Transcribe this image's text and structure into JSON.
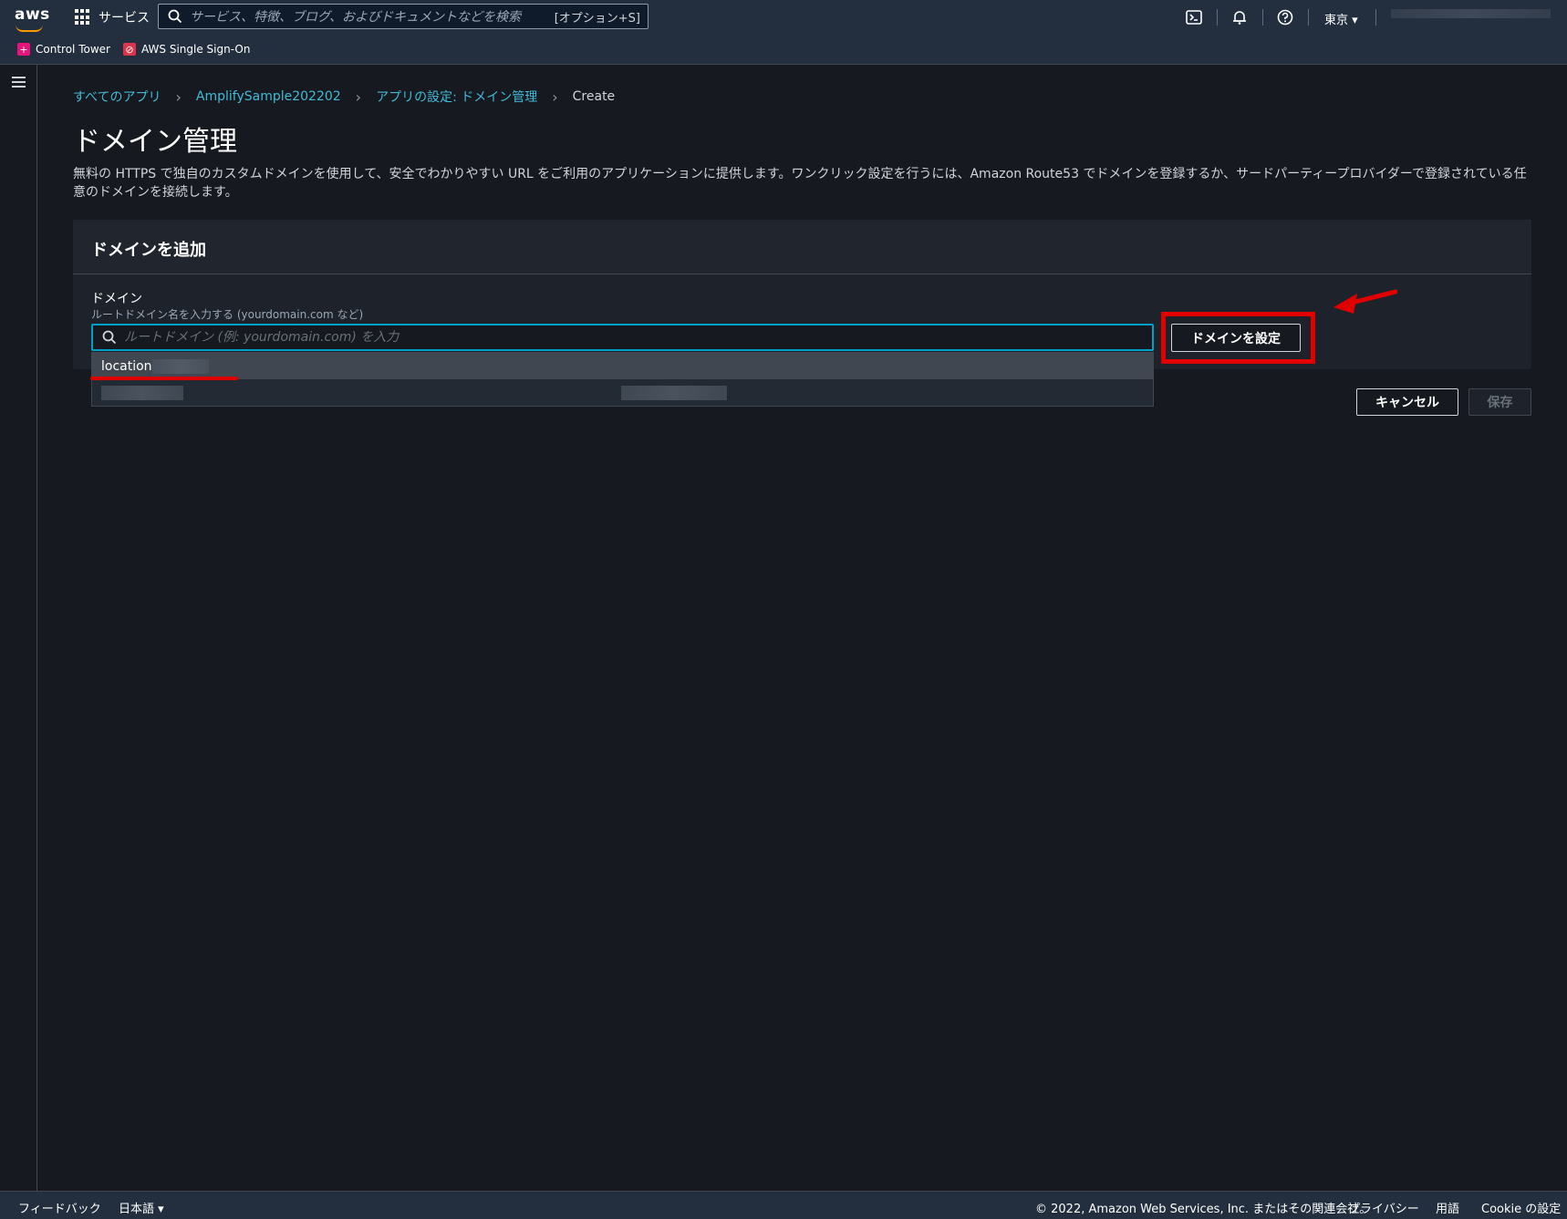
{
  "topbar": {
    "logo": "aws",
    "services_label": "サービス",
    "search_placeholder": "サービス、特徴、ブログ、およびドキュメントなどを検索",
    "search_shortcut": "[オプション+S]",
    "region": "東京 ▾",
    "icons": [
      "cloudshell-icon",
      "bell-icon",
      "help-icon"
    ]
  },
  "favorites": [
    {
      "label": "Control Tower",
      "color": "#e7157b"
    },
    {
      "label": "AWS Single Sign-On",
      "color": "#dd344c"
    }
  ],
  "breadcrumb": {
    "items": [
      "すべてのアプリ",
      "AmplifySample202202",
      "アプリの設定: ドメイン管理"
    ],
    "current": "Create"
  },
  "page": {
    "title": "ドメイン管理",
    "description": "無料の HTTPS で独自のカスタムドメインを使用して、安全でわかりやすい URL をご利用のアプリケーションに提供します。ワンクリック設定を行うには、Amazon Route53 でドメインを登録するか、サードパーティープロバイダーで登録されている任意のドメインを接続します。"
  },
  "panel": {
    "title": "ドメインを追加",
    "field_label": "ドメイン",
    "field_description": "ルートドメイン名を入力する (yourdomain.com など)",
    "input_placeholder": "ルートドメイン (例: yourdomain.com) を入力",
    "input_value": "",
    "dropdown_options": [
      "location"
    ],
    "configure_button": "ドメインを設定"
  },
  "actions": {
    "cancel": "キャンセル",
    "save": "保存"
  },
  "footer": {
    "feedback": "フィードバック",
    "language": "日本語 ▾",
    "copyright": "© 2022, Amazon Web Services, Inc. またはその関連会社。",
    "privacy": "プライバシー",
    "terms": "用語",
    "cookie": "Cookie の設定"
  },
  "colors": {
    "link": "#44b9d6",
    "focus": "#00a1c9",
    "annotation": "#e00000",
    "aws_orange": "#ff9900"
  }
}
